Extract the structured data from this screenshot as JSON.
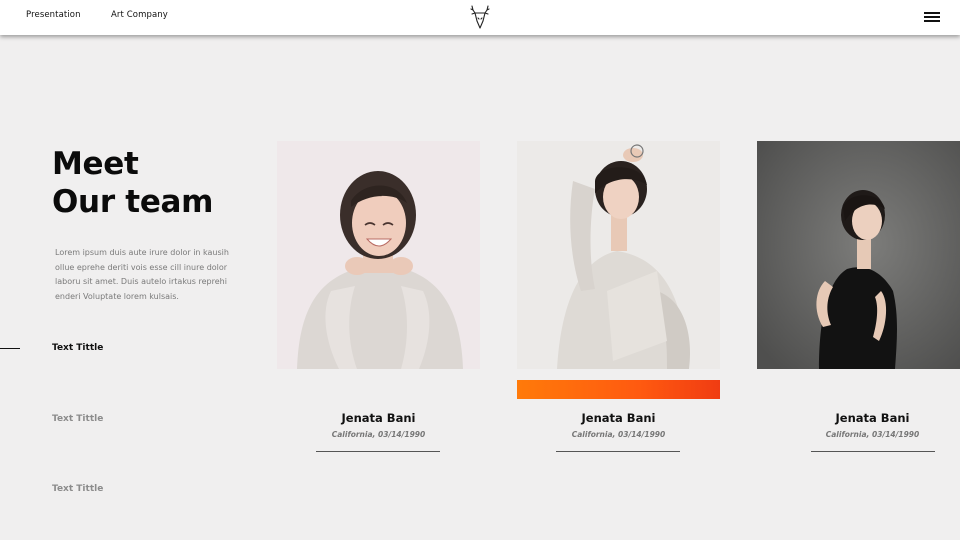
{
  "header": {
    "nav_links": [
      "Presentation",
      "Art Company"
    ],
    "logo_icon": "deer-head-icon",
    "menu_icon": "hamburger-menu-icon"
  },
  "intro": {
    "heading_line1": "Meet",
    "heading_line2": "Our team",
    "description": "Lorem  ipsum duis aute irure dolor in kausih ollue eprehe deriti vois esse cill inure dolor laboru sit amet. Duis autelo irtakus reprehi enderi Voluptate lorem kulsais."
  },
  "side_nav": {
    "items": [
      "Text Tittle",
      "Text Tittle",
      "Text Tittle"
    ],
    "active_index": 0
  },
  "team": [
    {
      "name": "Jenata Bani",
      "location": "California,",
      "date": "03/14/1990",
      "photo": "smiling-woman-sweater-photo"
    },
    {
      "name": "Jenata Bani",
      "location": "California,",
      "date": "03/14/1990",
      "photo": "woman-white-outfit-photo"
    },
    {
      "name": "Jenata Bani",
      "location": "California,",
      "date": "03/14/1990",
      "photo": "woman-black-outfit-photo"
    }
  ],
  "colors": {
    "background": "#f0efef",
    "accent_start": "#ff7a0a",
    "accent_end": "#f03c12"
  }
}
